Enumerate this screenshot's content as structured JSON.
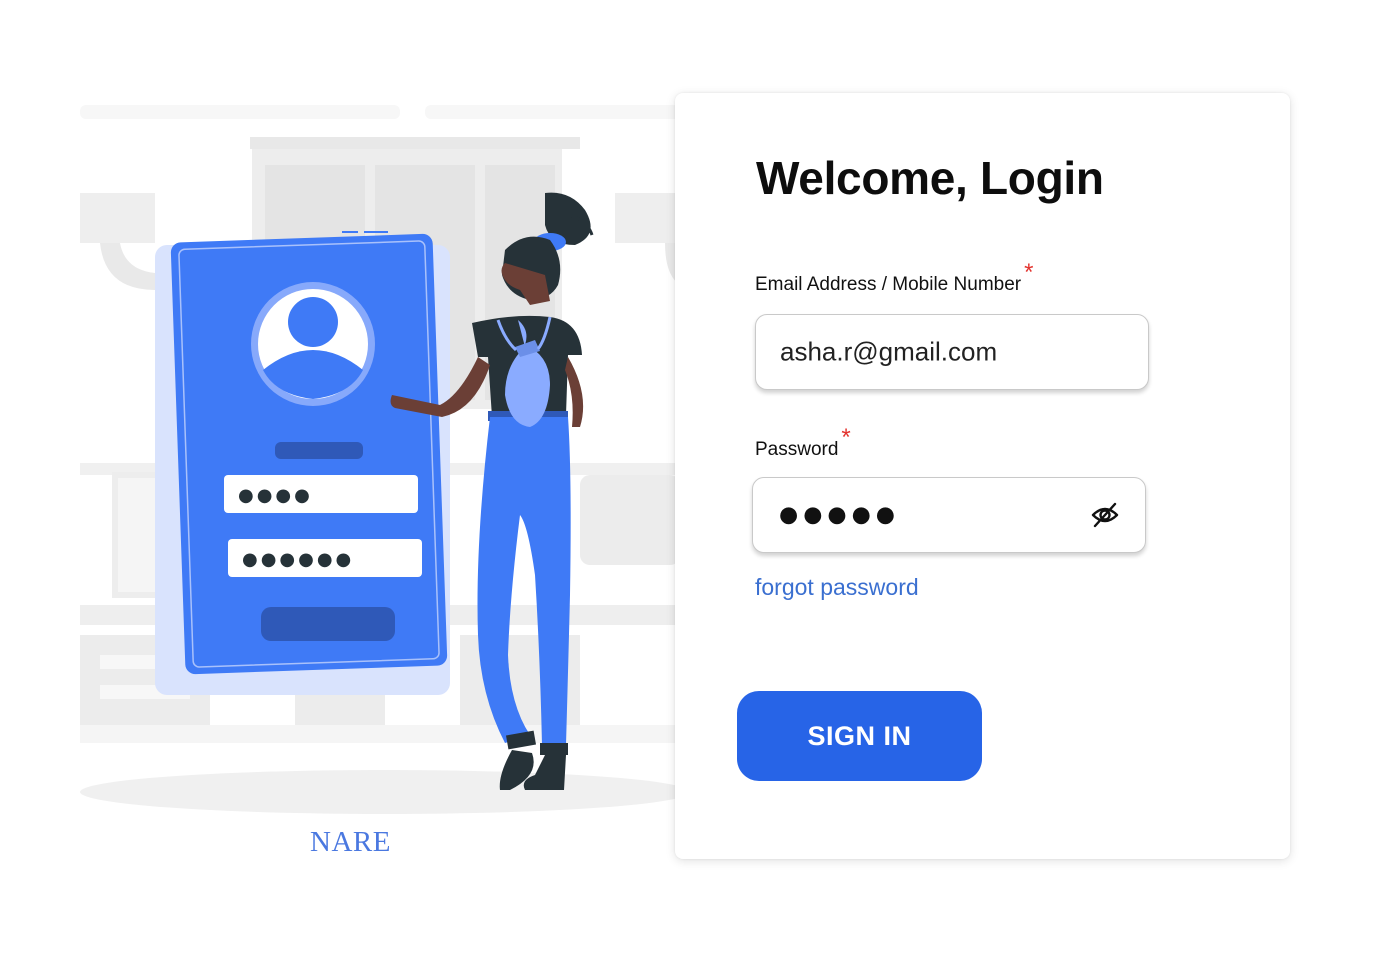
{
  "illustration": {
    "brand_text": "NARE",
    "phone_username_dots": "●●●●",
    "phone_password_dots": "●●●●●●",
    "colors": {
      "phone": "#3f7af6",
      "phone_back": "#d9e3fd",
      "accent_dark": "#2f59b8",
      "figure_dark": "#263238",
      "background_furniture": "#f2f2f2"
    }
  },
  "login": {
    "title": "Welcome, Login",
    "email_label": "Email Address /  Mobile Number",
    "email_required_mark": "*",
    "email_value": "asha.r@gmail.com",
    "password_label": "Password",
    "password_required_mark": "*",
    "password_masked": "●●●●●",
    "visibility_icon": "eye-off-icon",
    "forgot_link": "forgot password",
    "signin_label": "SIGN IN"
  },
  "colors": {
    "accent": "#2764e7",
    "link": "#3a6fd0",
    "required": "#e3342f",
    "brand": "#4a78e0"
  }
}
